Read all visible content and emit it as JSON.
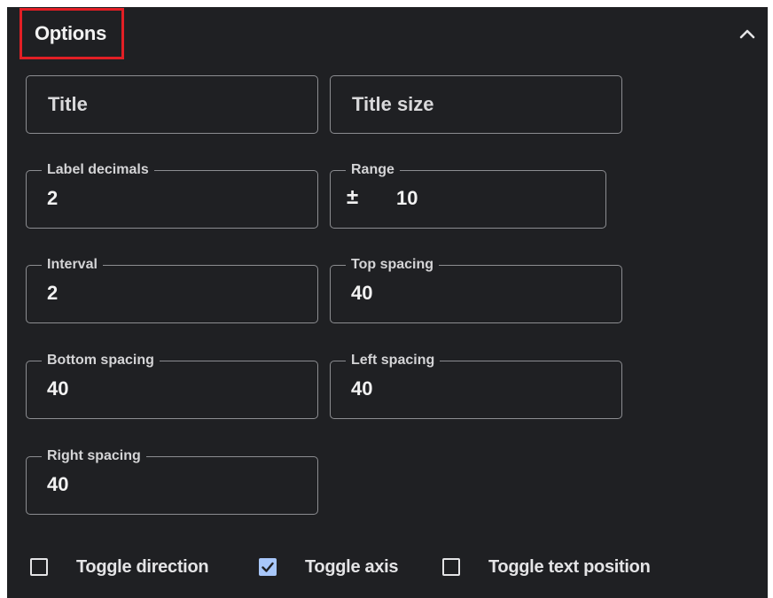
{
  "header": {
    "title": "Options",
    "collapse_icon": "chevron-up-icon"
  },
  "fields": {
    "title": {
      "placeholder": "Title",
      "value": ""
    },
    "title_size": {
      "placeholder": "Title size",
      "value": ""
    },
    "label_decimals": {
      "label": "Label decimals",
      "value": "2"
    },
    "range": {
      "label": "Range",
      "prefix": "±",
      "value": "10"
    },
    "interval": {
      "label": "Interval",
      "value": "2"
    },
    "top_spacing": {
      "label": "Top spacing",
      "value": "40"
    },
    "bottom_spacing": {
      "label": "Bottom spacing",
      "value": "40"
    },
    "left_spacing": {
      "label": "Left spacing",
      "value": "40"
    },
    "right_spacing": {
      "label": "Right spacing",
      "value": "40"
    }
  },
  "checkboxes": [
    {
      "label": "Toggle direction",
      "checked": false
    },
    {
      "label": "Toggle axis",
      "checked": true
    },
    {
      "label": "Toggle text position",
      "checked": false
    }
  ],
  "colors": {
    "panel_bg": "#1f2023",
    "highlight_border": "#e21f25",
    "checkbox_accent": "#a8c7fa"
  }
}
